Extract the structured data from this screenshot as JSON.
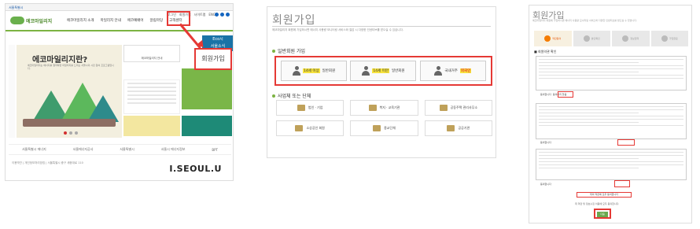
{
  "panel1": {
    "top_label": "서울특별시",
    "logo_text": "에코마일리지",
    "gnb": [
      "에코마일리지 소개",
      "마일리지 안내",
      "에코예배어",
      "알림마당",
      "고객센터"
    ],
    "util": [
      "로그인",
      "회원가입",
      "사이트맵",
      "ENG"
    ],
    "hero_title": "에코마일리지란?",
    "hero_desc": "에코마일리지는 에너지를 절약하면 마일리지를 드리는 서울시의 시민 참여 프로그램입니다.",
    "blue_box": [
      "Eco시",
      "서울소식"
    ],
    "join_label": "회원가입",
    "extra_label": "고객",
    "cards": [
      "에코마일리지 안내",
      "우리아파트",
      "마일리지 현황",
      "에코마일리지 FAQ"
    ],
    "partners": [
      "서울특별시 에너지",
      "서울에너지공사",
      "서울특별시",
      "서울시 에너지정보",
      "BPT"
    ],
    "footer": "이용약관 | 개인정보처리방침 | 서울특별시 중구 세종대로 110",
    "seoul_brand": "I.SEOUL.U"
  },
  "panel2": {
    "title": "회원가입",
    "desc": "에코마일리지 회원에 가입하시면 에너지 사용량 모니터링 서비스와 절감 시 다양한 인센티브를 받으실 수 있습니다.",
    "sec1": "일반회원 가입",
    "member_buttons": [
      {
        "hl": "14세 이상",
        "rest": "일반회원",
        "red": false
      },
      {
        "hl": "14세 미만",
        "rest": "일반회원",
        "red": false
      },
      {
        "hl": "",
        "pre": "국내거주 ",
        "rest": "외국인",
        "red": true
      }
    ],
    "sec2": "사업체 또는 단체",
    "org_buttons": [
      "법인 · 기업",
      "복지 · 교육기관",
      "공동주택 관리사무소",
      "소상공인 회원",
      "종교단체",
      "공공기관"
    ]
  },
  "panel3": {
    "title": "회원가입",
    "desc": "에코마일리지 회원에 가입하시면 에너지 사용량 모니터링 서비스와 다양한 인센티브를 받으실 수 있습니다.",
    "steps": [
      "약관동의",
      "본인확인",
      "정보입력",
      "가입완료"
    ],
    "heading": "■ 회원약관 확인",
    "agree1": "동의합니다",
    "disagree1": "동의하지 않음",
    "agree2": "동의합니다",
    "agree3": "동의합니다",
    "all_agree": "위의 약관에 모두 동의합니다",
    "note": "위 약관 및 정보수집 이용에 모두 동의합니다.",
    "next": "다음"
  }
}
